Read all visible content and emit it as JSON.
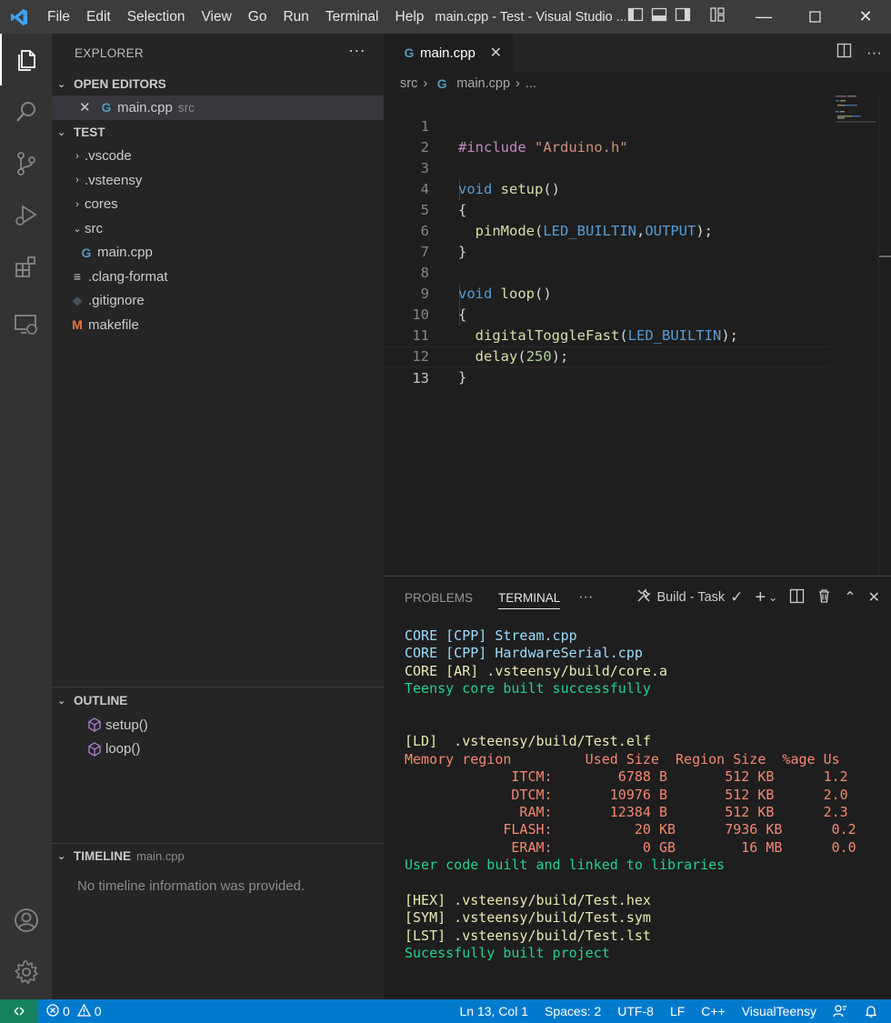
{
  "titlebar": {
    "menu": [
      "File",
      "Edit",
      "Selection",
      "View",
      "Go",
      "Run",
      "Terminal",
      "Help"
    ],
    "title": "main.cpp - Test - Visual Studio ..."
  },
  "activitybar": {
    "icons": [
      "explorer-icon",
      "search-icon",
      "source-control-icon",
      "run-debug-icon",
      "extensions-icon",
      "remote-explorer-icon",
      "account-icon",
      "settings-gear-icon"
    ]
  },
  "sidebar": {
    "title": "EXPLORER",
    "open_editors": {
      "label": "OPEN EDITORS",
      "items": [
        {
          "name": "main.cpp",
          "folder": "src"
        }
      ]
    },
    "project": {
      "label": "TEST",
      "items": [
        {
          "name": ".vscode",
          "type": "folder",
          "state": "collapsed"
        },
        {
          "name": ".vsteensy",
          "type": "folder",
          "state": "collapsed"
        },
        {
          "name": "cores",
          "type": "folder",
          "state": "collapsed"
        },
        {
          "name": "src",
          "type": "folder",
          "state": "expanded"
        },
        {
          "name": "main.cpp",
          "type": "file"
        },
        {
          "name": ".clang-format",
          "type": "file"
        },
        {
          "name": ".gitignore",
          "type": "file"
        },
        {
          "name": "makefile",
          "type": "file"
        }
      ]
    },
    "outline": {
      "label": "OUTLINE",
      "items": [
        "setup()",
        "loop()"
      ]
    },
    "timeline": {
      "label": "TIMELINE",
      "file": "main.cpp",
      "message": "No timeline information was provided."
    }
  },
  "editor": {
    "tab": "main.cpp",
    "breadcrumb": [
      "src",
      "main.cpp",
      "..."
    ],
    "lines": [
      "#include \"Arduino.h\"",
      "",
      "void setup()",
      "{",
      "  pinMode(LED_BUILTIN,OUTPUT);",
      "}",
      "",
      "void loop()",
      "{",
      "  digitalToggleFast(LED_BUILTIN);",
      "  delay(250);",
      "}",
      ""
    ],
    "current_line": 13
  },
  "panel": {
    "tabs": [
      "PROBLEMS",
      "TERMINAL"
    ],
    "active_tab": "TERMINAL",
    "task_label": "Build - Task",
    "terminal": [
      {
        "text": "CORE [CPP] Stream.cpp",
        "color": "#9cdcfe"
      },
      {
        "text": "CORE [CPP] HardwareSerial.cpp",
        "color": "#9cdcfe"
      },
      {
        "text": "CORE [AR] .vsteensy/build/core.a",
        "color": "#e9e9b0"
      },
      {
        "text": "Teensy core built successfully",
        "color": "#23d18b"
      },
      {
        "text": "",
        "color": "#e5e5e5"
      },
      {
        "text": "",
        "color": "#e5e5e5"
      },
      {
        "text": "[LD]  .vsteensy/build/Test.elf",
        "color": "#e9e9b0"
      },
      {
        "text": "Memory region         Used Size  Region Size  %age Us",
        "color": "#f48771"
      },
      {
        "text": "             ITCM:        6788 B       512 KB      1.2",
        "color": "#f48771"
      },
      {
        "text": "             DTCM:       10976 B       512 KB      2.0",
        "color": "#f48771"
      },
      {
        "text": "              RAM:       12384 B       512 KB      2.3",
        "color": "#f48771"
      },
      {
        "text": "            FLASH:          20 KB      7936 KB      0.2",
        "color": "#f48771"
      },
      {
        "text": "             ERAM:           0 GB        16 MB      0.0",
        "color": "#f48771"
      },
      {
        "text": "User code built and linked to libraries",
        "color": "#23d18b"
      },
      {
        "text": "",
        "color": "#e5e5e5"
      },
      {
        "text": "[HEX] .vsteensy/build/Test.hex",
        "color": "#e9e9b0"
      },
      {
        "text": "[SYM] .vsteensy/build/Test.sym",
        "color": "#e9e9b0"
      },
      {
        "text": "[LST] .vsteensy/build/Test.lst",
        "color": "#e9e9b0"
      },
      {
        "text": "Sucessfully built project",
        "color": "#23d18b"
      }
    ]
  },
  "statusbar": {
    "errors": "0",
    "warnings": "0",
    "position": "Ln 13, Col 1",
    "spaces": "Spaces: 2",
    "encoding": "UTF-8",
    "eol": "LF",
    "language": "C++",
    "extension": "VisualTeensy"
  },
  "colors": {
    "accent": "#007acc",
    "remote": "#16825d",
    "activity_bar": "#333333",
    "sidebar": "#252526",
    "editor": "#1e1e1e"
  }
}
